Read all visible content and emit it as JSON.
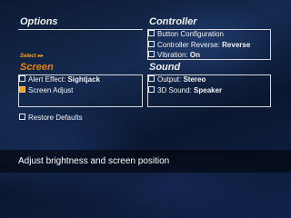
{
  "options": {
    "title": "Options",
    "select_label": "Select ▸▸"
  },
  "controller": {
    "title": "Controller",
    "items": [
      {
        "label": "Button Configuration",
        "value": "",
        "checked": false
      },
      {
        "label": "Controller Reverse: ",
        "value": "Reverse",
        "checked": false
      },
      {
        "label": "Vibration: ",
        "value": "On",
        "checked": false
      }
    ]
  },
  "screen": {
    "title": "Screen",
    "items": [
      {
        "label": "Alert Effect: ",
        "value": "Sightjack",
        "checked": false
      },
      {
        "label": "Screen Adjust",
        "value": "",
        "checked": true
      }
    ]
  },
  "sound": {
    "title": "Sound",
    "items": [
      {
        "label": "Output: ",
        "value": "Stereo",
        "checked": false
      },
      {
        "label": "3D Sound: ",
        "value": "Speaker",
        "checked": false
      }
    ]
  },
  "restore": {
    "label": "Restore Defaults",
    "checked": false
  },
  "help": {
    "text": "Adjust brightness and screen position"
  },
  "colors": {
    "accent": "#f0a020",
    "screen_header": "#e8820a"
  }
}
